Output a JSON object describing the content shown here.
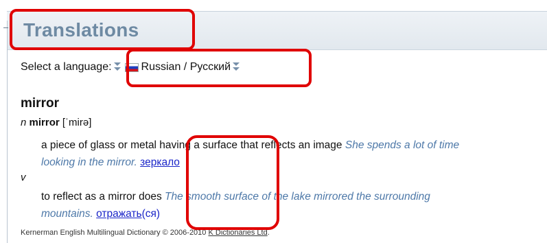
{
  "header": {
    "title": "Translations"
  },
  "language_selector": {
    "label": "Select a language:",
    "selected": "Russian / Русский"
  },
  "entry": {
    "headword": "mirror",
    "senses": [
      {
        "pos": "n",
        "headword": "mirror",
        "pronunciation": "[ˈmirə]",
        "definition": "a piece of glass or metal having a surface that reflects an image",
        "example": "She spends a lot of time looking in the mirror.",
        "translation": "зеркало"
      },
      {
        "pos": "v",
        "definition": "to reflect as a mirror does",
        "example": "The smooth surface of the lake mirrored the surrounding mountains.",
        "translation": "отражать",
        "translation_suffix": "(ся)"
      }
    ]
  },
  "footer": {
    "text": "Kernerman English Multilingual Dictionary © 2006-2010",
    "link": "K Dictionaries Ltd",
    "after": "."
  },
  "colors": {
    "highlight_box": "#e00000",
    "header_text": "#6e8aa3",
    "example_text": "#4d78a8",
    "translation_link": "#1a25c8"
  },
  "icons": [
    "sort-arrows-icon",
    "russia-flag-icon",
    "sort-arrows-icon"
  ]
}
